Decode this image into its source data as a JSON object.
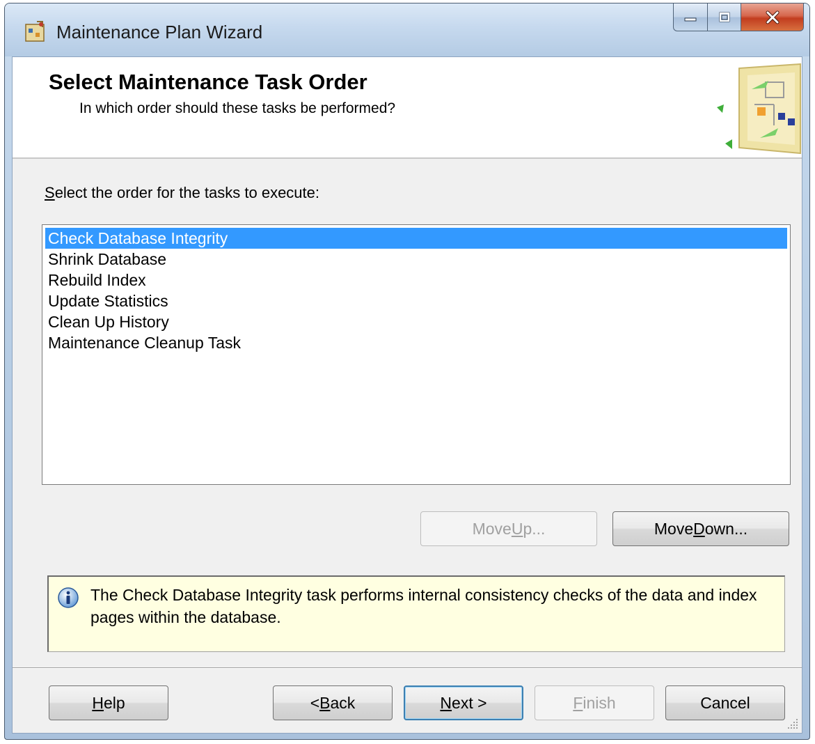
{
  "window": {
    "title": "Maintenance Plan Wizard",
    "icon": "wizard-app-icon",
    "caption_buttons": [
      "minimize-icon",
      "maximize-icon",
      "close-icon"
    ]
  },
  "header": {
    "title": "Select Maintenance Task Order",
    "subtitle": "In which order should these tasks be performed?"
  },
  "instruction": {
    "mnemonic": "S",
    "rest": "elect the order for the tasks to execute:"
  },
  "task_list": {
    "items": [
      "Check Database Integrity",
      "Shrink Database",
      "Rebuild Index",
      "Update Statistics",
      "Clean Up History",
      "Maintenance Cleanup Task"
    ],
    "selected_index": 0
  },
  "order_buttons": {
    "move_up": {
      "pre": "Move ",
      "mnemonic": "U",
      "post": "p..."
    },
    "move_down": {
      "pre": "Move ",
      "mnemonic": "D",
      "post": "own..."
    }
  },
  "info": {
    "icon": "info-icon",
    "text": "The Check Database Integrity task performs internal consistency checks of the data and index pages within the database."
  },
  "footer_buttons": {
    "help": {
      "pre": "",
      "mnemonic": "H",
      "post": "elp"
    },
    "back": {
      "pre": "< ",
      "mnemonic": "B",
      "post": "ack"
    },
    "next": {
      "pre": "",
      "mnemonic": "N",
      "post": "ext >"
    },
    "finish": {
      "pre": "",
      "mnemonic": "F",
      "post": "inish"
    },
    "cancel": {
      "pre": "",
      "mnemonic": "",
      "post": "Cancel"
    }
  },
  "colors": {
    "selection": "#3399ff",
    "info_background": "#ffffe1",
    "dialog_background": "#f0f0f0"
  }
}
